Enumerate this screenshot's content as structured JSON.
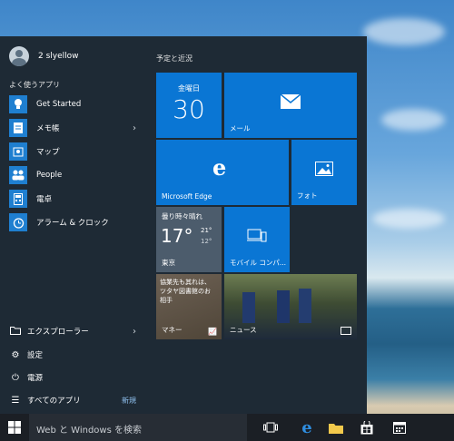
{
  "user": {
    "name": "2 slyellow"
  },
  "most_used_header": "よく使うアプリ",
  "apps": [
    {
      "label": "Get Started",
      "icon": "lightbulb-icon"
    },
    {
      "label": "メモ帳",
      "icon": "notepad-icon",
      "has_submenu": true
    },
    {
      "label": "マップ",
      "icon": "maps-icon"
    },
    {
      "label": "People",
      "icon": "people-icon"
    },
    {
      "label": "電卓",
      "icon": "calculator-icon"
    },
    {
      "label": "アラーム & クロック",
      "icon": "alarm-clock-icon"
    }
  ],
  "bottom": {
    "explorer": "エクスプローラー",
    "settings": "設定",
    "power": "電源",
    "all_apps": "すべてのアプリ",
    "new_badge": "新規"
  },
  "tiles_header": "予定と近況",
  "tiles": {
    "calendar": {
      "day": "金曜日",
      "date": "30"
    },
    "mail": "メール",
    "edge": "Microsoft Edge",
    "photos": "フォト",
    "weather": {
      "condition": "曇り時々晴れ",
      "temp": "17°",
      "high": "21°",
      "low": "12°",
      "city": "東京"
    },
    "phone": "モバイル コンパ...",
    "money": {
      "headline": "協業先も其れは、\nツタヤ図書館のお\n相手",
      "label": "マネー"
    },
    "news": "ニュース"
  },
  "taskbar": {
    "search_placeholder": "Web と Windows を検索",
    "icons": [
      "windows-start-icon",
      "task-view-icon",
      "edge-icon",
      "file-explorer-icon",
      "store-icon",
      "calendar-icon"
    ]
  },
  "colors": {
    "accent": "#0a76d4",
    "menu_bg": "#1e2a35",
    "taskbar_bg": "#1b1f25"
  }
}
